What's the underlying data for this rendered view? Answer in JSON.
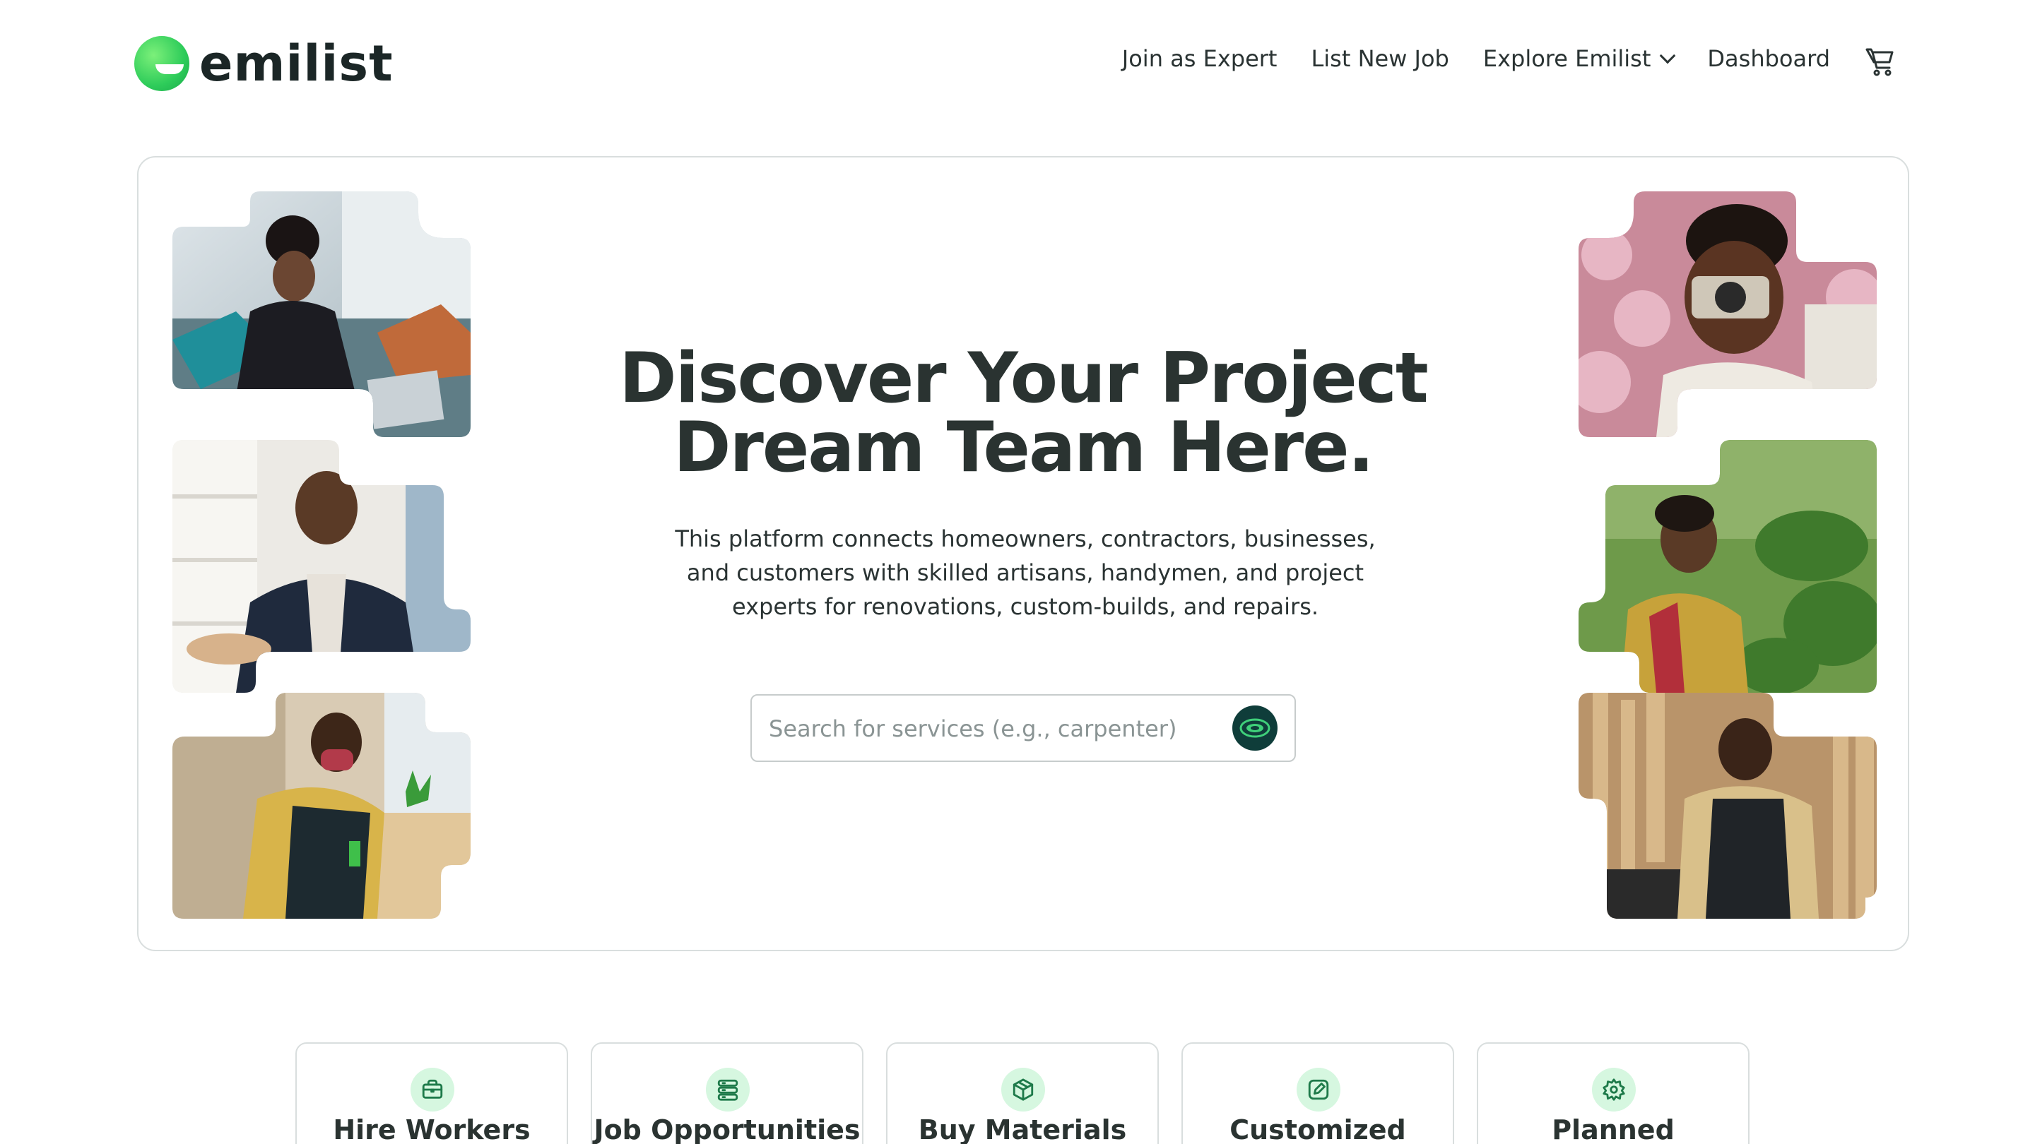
{
  "brand": {
    "name": "emilist"
  },
  "nav": {
    "items": [
      {
        "label": "Join as Expert"
      },
      {
        "label": "List New Job"
      },
      {
        "label": "Explore Emilist"
      },
      {
        "label": "Dashboard"
      }
    ]
  },
  "hero": {
    "title_line1": "Discover Your Project",
    "title_line2": "Dream Team Here.",
    "description": "This platform connects homeowners, contractors, businesses, and customers with skilled artisans, handymen, and project experts for renovations, custom-builds, and repairs.",
    "search_placeholder": "Search for services (e.g., carpenter)"
  },
  "photos": [
    {
      "subject": "woman working on laptop"
    },
    {
      "subject": "smiling man in blazer"
    },
    {
      "subject": "man cleaning table with mask"
    },
    {
      "subject": "man taking photo with camera"
    },
    {
      "subject": "woman in garden with plants"
    },
    {
      "subject": "carpenter in workshop"
    }
  ],
  "features": [
    {
      "label": "Hire Workers",
      "icon": "briefcase-icon"
    },
    {
      "label": "Job Opportunities",
      "icon": "server-list-icon"
    },
    {
      "label": "Buy Materials",
      "icon": "box-icon"
    },
    {
      "label": "Customized",
      "icon": "edit-pen-icon"
    },
    {
      "label": "Planned",
      "icon": "settings-gear-icon"
    }
  ],
  "colors": {
    "brand_green": "#2ecc5a",
    "dark_teal": "#0f3d3a",
    "icon_bg": "#d6f7e0",
    "icon_stroke": "#1e7a4a"
  }
}
